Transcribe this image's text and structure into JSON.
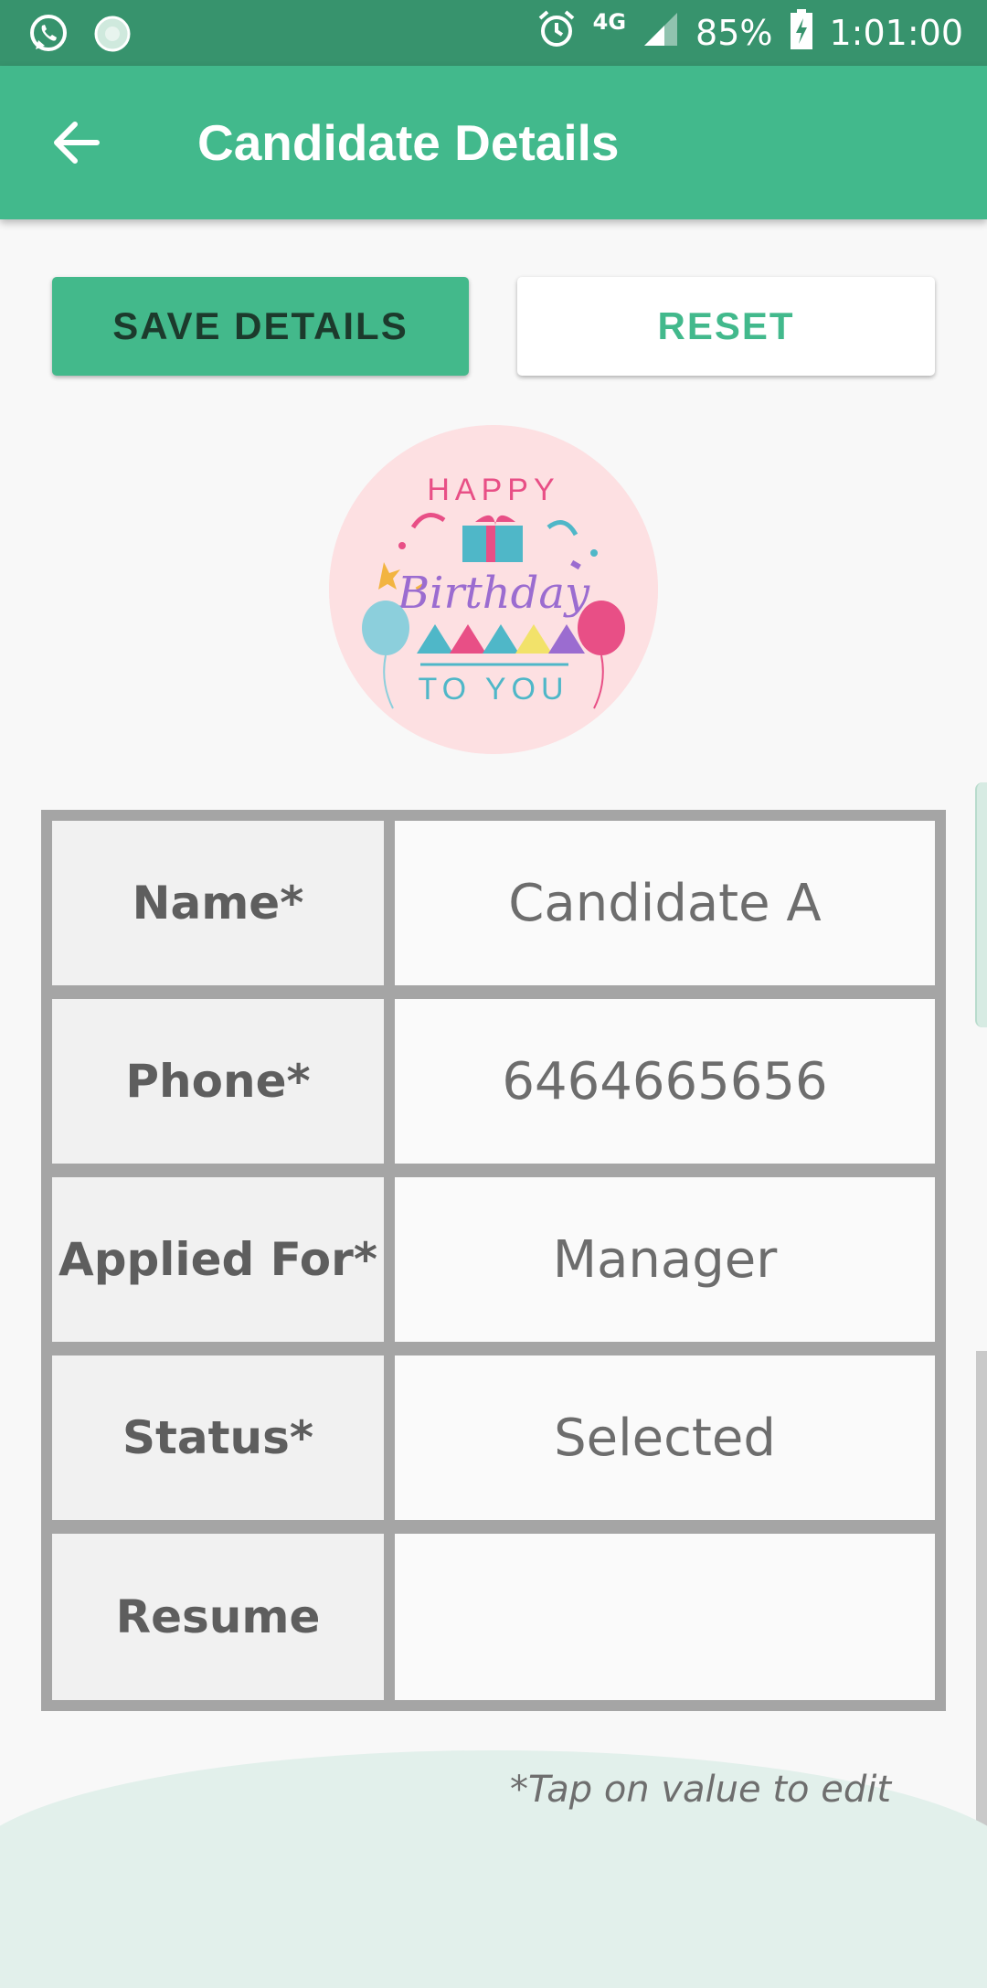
{
  "status_bar": {
    "icons_left": [
      "whatsapp-icon",
      "loading-icon"
    ],
    "network": "4G",
    "battery": "85%",
    "time": "1:01:00"
  },
  "app_bar": {
    "title": "Candidate Details",
    "back_icon": "arrow-back-icon"
  },
  "actions": {
    "save_label": "SAVE DETAILS",
    "reset_label": "RESET"
  },
  "avatar": {
    "description": "birthday-image",
    "text_top": "HAPPY",
    "text_middle": "Birthday",
    "text_bottom": "TO YOU"
  },
  "details": {
    "rows": [
      {
        "label": "Name*",
        "value": "Candidate A"
      },
      {
        "label": "Phone*",
        "value": "6464665656"
      },
      {
        "label": "Applied For*",
        "value": "Manager"
      },
      {
        "label": "Status*",
        "value": "Selected"
      },
      {
        "label": "Resume",
        "value": ""
      }
    ]
  },
  "hint": "*Tap on value to edit",
  "colors": {
    "status_bar": "#37936d",
    "primary": "#42b98c",
    "table_border": "#a5a5a5"
  }
}
